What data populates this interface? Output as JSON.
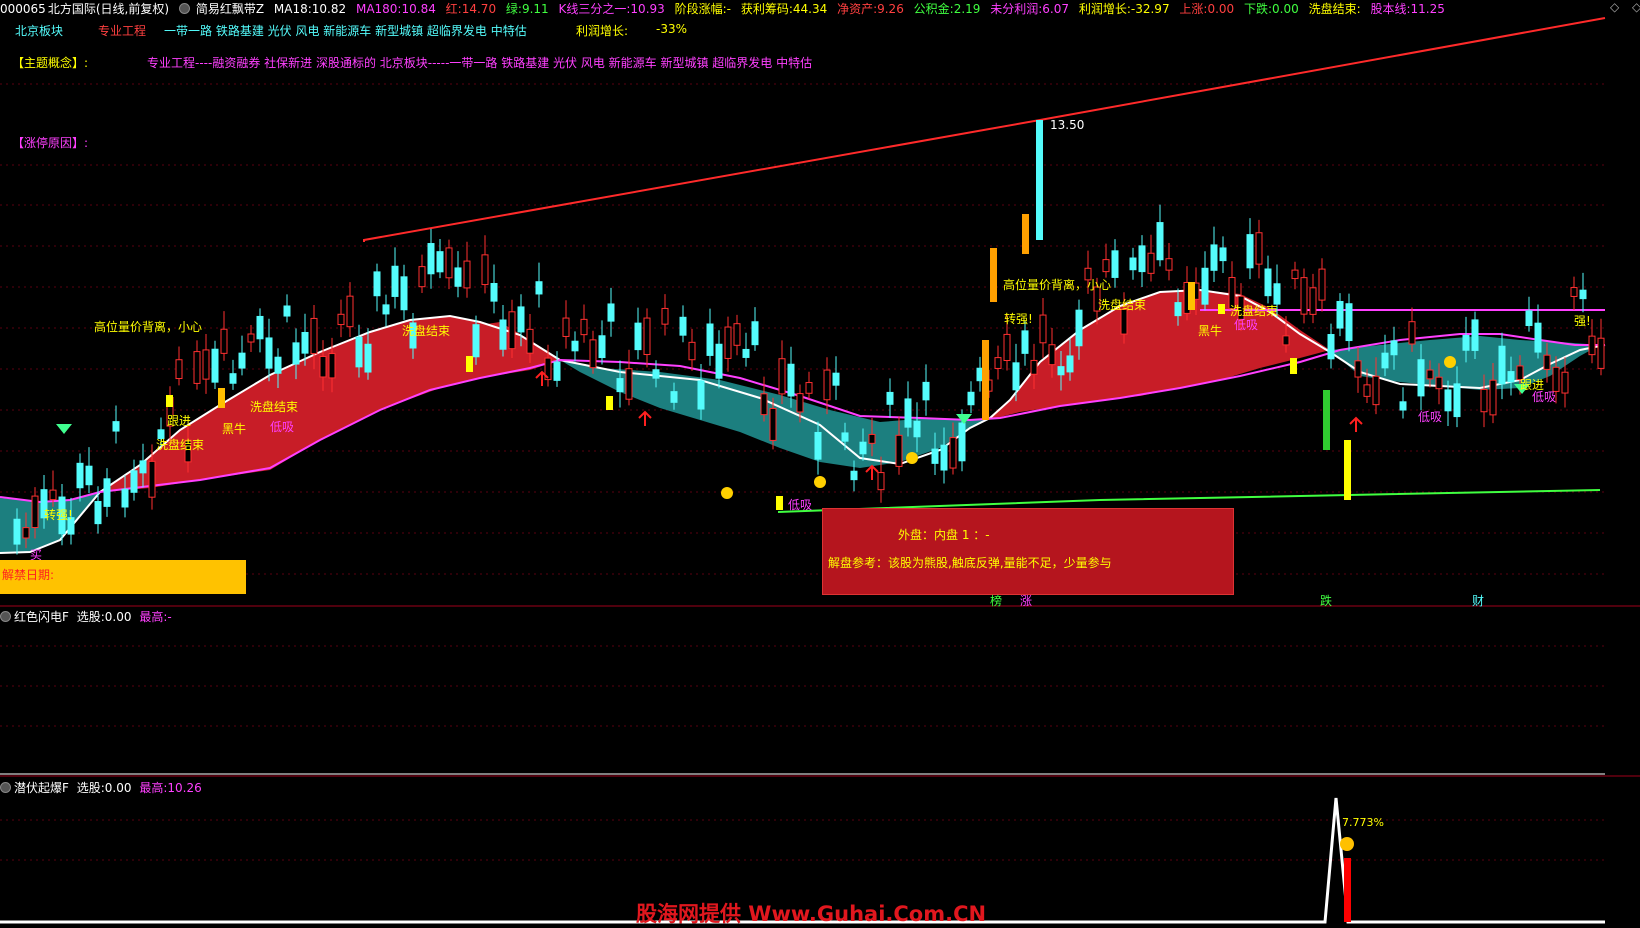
{
  "colors": {
    "red": "#ff2a2a",
    "cyan": "#54fcfc",
    "magenta": "#ff40ff",
    "yellow": "#ffff00",
    "green": "#40ff40",
    "orange": "#ff9a00",
    "white": "#ffffff",
    "bgred": "#b5151e",
    "teal": "#1c7f7f",
    "brown": "#c81d27"
  },
  "header": {
    "code": "000065",
    "name": "北方国际",
    "mode": "(日线,前复权)",
    "indicator": "简易红飘带Z",
    "ma18_label": "MA18:",
    "ma18": "10.82",
    "ma180_label": "MA180:",
    "ma180": "10.84",
    "red_label": "红:",
    "red": "14.70",
    "green_label": "绿:",
    "green": "9.11",
    "k3_label": "K线三分之一:",
    "k3": "10.93",
    "stage_label": "阶段涨幅:",
    "stage": "-",
    "profit_label": "获利筹码:",
    "profit": "44.34",
    "netasset_label": "净资产:",
    "netasset": "9.26",
    "fund_label": "公积金:",
    "fund": "2.19",
    "undist_label": "未分利润:",
    "undist": "6.07",
    "pgrowth_label": "利润增长:",
    "pgrowth": "-32.97",
    "up_label": "上涨:",
    "up": "0.00",
    "down_label": "下跌:",
    "down": "0.00",
    "wash_label": "洗盘结束:",
    "share_label": "股本线:",
    "share": "11.25"
  },
  "row2": {
    "sector": "北京板块",
    "industry": "专业工程",
    "concepts": "一带一路 铁路基建 光伏 风电 新能源车 新型城镇 超临界发电 中特估",
    "growth_label": "利润增长:",
    "growth": "-33%"
  },
  "theme_label": "【主题概念】:",
  "theme_text": "专业工程----融资融券 社保新进 深股通标的 北京板块-----一带一路 铁路基建 光伏 风电 新能源车 新型城镇 超临界发电 中特估",
  "limitup_label": "【涨停原因】:",
  "peak_label": "13.50",
  "signals": {
    "high_div": "高位量价背离，小心",
    "wash_end": "洗盘结束",
    "follow": "跟进",
    "black_bull": "黑牛",
    "low_buy": "低吸",
    "turn_strong": "转强!",
    "buy": "买",
    "strong": "强!",
    "low_suck": "低吸"
  },
  "unlock_label": "解禁日期:",
  "info_box": {
    "line1": "外盘：内盘   1  ：-",
    "line2": "解盘参考：该股为熊股,触底反弹,量能不足，少量参与"
  },
  "marks": {
    "m1": "榜",
    "m2": "涨",
    "m3": "跌",
    "m4": "财"
  },
  "panel2": {
    "name": "红色闪电F",
    "sel_label": "选股:",
    "sel": "0.00",
    "max_label": "最高:",
    "max": "-"
  },
  "panel3": {
    "name": "潜伏起爆F",
    "sel_label": "选股:",
    "sel": "0.00",
    "max_label": "最高:",
    "max": "10.26",
    "spike_label": "7.773%"
  },
  "watermark": "股海网提供 Www.Guhai.Com.CN"
}
